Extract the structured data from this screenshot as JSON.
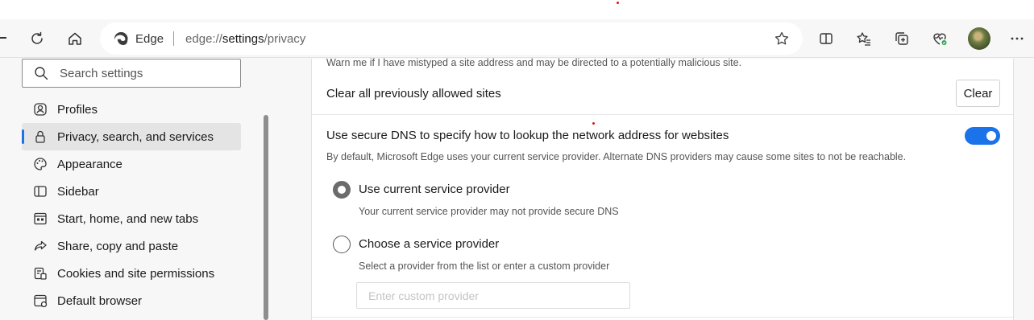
{
  "browser": {
    "edge_label": "Edge",
    "url": {
      "scheme": "edge://",
      "host": "settings",
      "path": "/privacy"
    }
  },
  "icons": {
    "refresh": "refresh-icon",
    "home": "home-icon",
    "favorite": "star-icon",
    "split": "split-screen-icon",
    "favorites": "favorites-icon",
    "collections": "collections-icon",
    "health": "browser-essentials-icon",
    "more": "more-icon"
  },
  "sidebar": {
    "search_placeholder": "Search settings",
    "items": [
      {
        "label": "Profiles",
        "icon": "profile-icon",
        "active": false
      },
      {
        "label": "Privacy, search, and services",
        "icon": "lock-icon",
        "active": true
      },
      {
        "label": "Appearance",
        "icon": "palette-icon",
        "active": false
      },
      {
        "label": "Sidebar",
        "icon": "sidebar-icon",
        "active": false
      },
      {
        "label": "Start, home, and new tabs",
        "icon": "start-page-icon",
        "active": false
      },
      {
        "label": "Share, copy and paste",
        "icon": "share-icon",
        "active": false
      },
      {
        "label": "Cookies and site permissions",
        "icon": "cookies-icon",
        "active": false
      },
      {
        "label": "Default browser",
        "icon": "default-browser-icon",
        "active": false
      }
    ]
  },
  "main": {
    "warn_text": "Warn me if I have mistyped a site address and may be directed to a potentially malicious site.",
    "clear_sites_title": "Clear all previously allowed sites",
    "clear_button": "Clear",
    "dns_title": "Use secure DNS to specify how to lookup the network address for websites",
    "dns_description": "By default, Microsoft Edge uses your current service provider. Alternate DNS providers may cause some sites to not be reachable.",
    "dns_enabled": true,
    "options": [
      {
        "label": "Use current service provider",
        "sub": "Your current service provider may not provide secure DNS",
        "checked": true
      },
      {
        "label": "Choose a service provider",
        "sub": "Select a provider from the list or enter a custom provider",
        "checked": false
      }
    ],
    "custom_provider_placeholder": "Enter custom provider"
  },
  "colors": {
    "accent": "#1a73e8",
    "background": "#f7f7f7",
    "card": "#ffffff"
  }
}
